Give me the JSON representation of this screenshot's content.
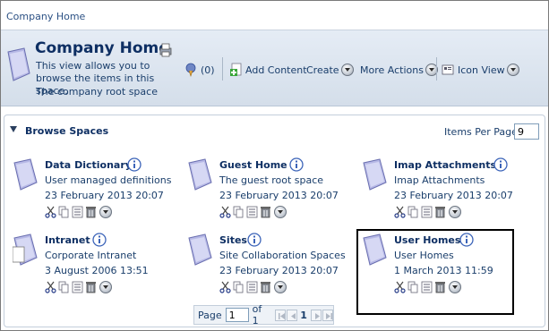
{
  "breadcrumb": {
    "label": "Company Home"
  },
  "header": {
    "title": "Company Home",
    "description": "This view allows you to browse the items in this space.",
    "space_description": "The company root space",
    "rss_count": "(0)"
  },
  "toolbar": {
    "add_content": "Add Content",
    "create": "Create",
    "more_actions": "More Actions",
    "view": "Icon View"
  },
  "browse": {
    "title": "Browse Spaces",
    "items_per_page_label": "Items Per Page",
    "items_per_page_value": "9",
    "items": [
      {
        "name": "Data Dictionary",
        "description": "User managed definitions",
        "date": "23 February 2013 20:07"
      },
      {
        "name": "Guest Home",
        "description": "The guest root space",
        "date": "23 February 2013 20:07"
      },
      {
        "name": "Imap Attachments",
        "description": "Imap Attachments",
        "date": "23 February 2013 20:07"
      },
      {
        "name": "Intranet",
        "description": "Corporate Intranet",
        "date": "3 August 2006 13:51"
      },
      {
        "name": "Sites",
        "description": "Site Collaboration Spaces",
        "date": "23 February 2013 20:07"
      },
      {
        "name": "User Homes",
        "description": "User Homes",
        "date": "1 March 2013 11:59"
      }
    ]
  },
  "pager": {
    "page_label": "Page",
    "page_value": "1",
    "of_label": "of 1",
    "current_page": "1"
  },
  "colors": {
    "accent": "#0e2f63",
    "header_bg": "#dbe4ef",
    "highlight_border": "#000000"
  }
}
